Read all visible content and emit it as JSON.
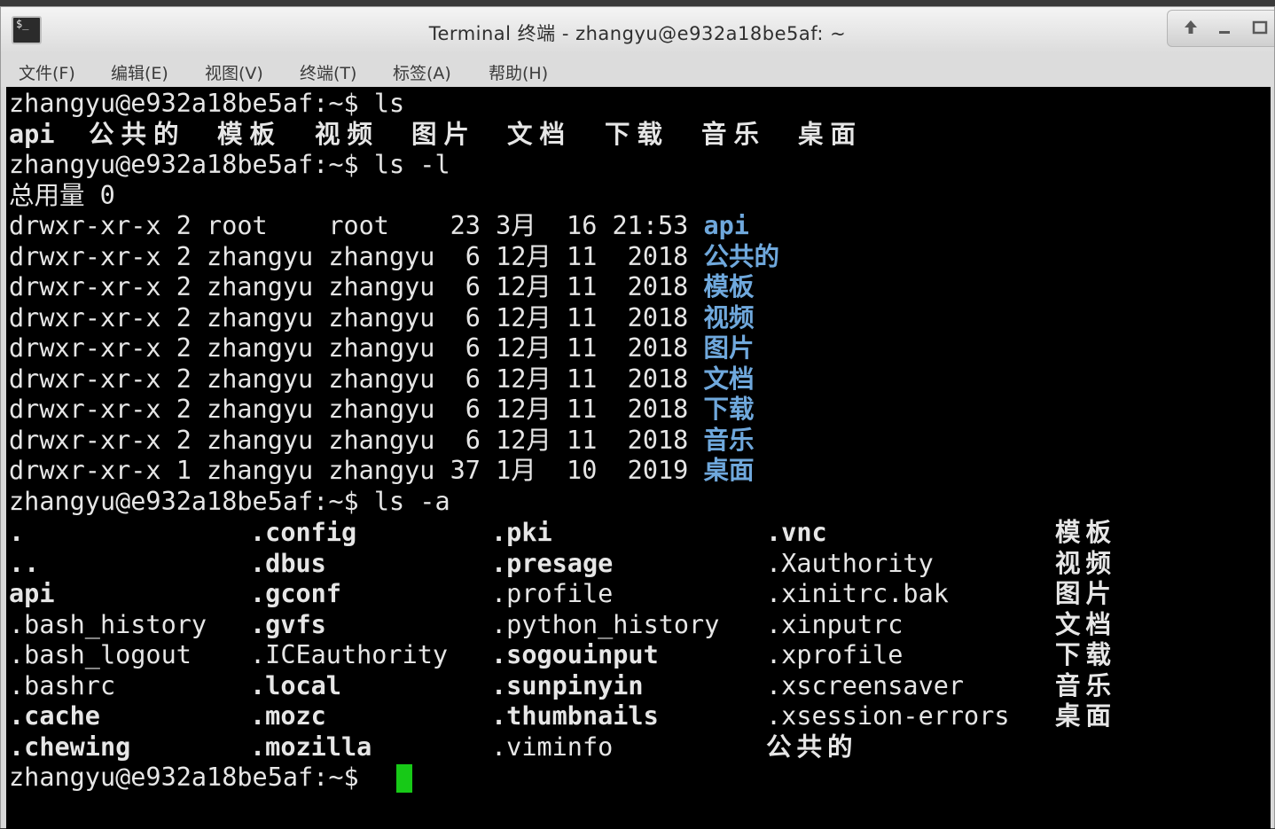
{
  "window": {
    "title": "Terminal 终端 - zhangyu@e932a18be5af: ~",
    "app_icon_prompt": "$_",
    "controls": [
      "up-arrow-icon",
      "minimize-icon",
      "maximize-icon"
    ]
  },
  "menu": [
    "文件(F)",
    "编辑(E)",
    "视图(V)",
    "终端(T)",
    "标签(A)",
    "帮助(H)"
  ],
  "terminal": {
    "prompt": "zhangyu@e932a18be5af:~$ ",
    "colors": {
      "background": "#000000",
      "text": "#e6e6e6",
      "directory": "#6fa8dc",
      "cursor": "#17c917"
    },
    "cmd1": "ls",
    "ls_output": [
      "api",
      "公共的",
      "模板",
      "视频",
      "图片",
      "文档",
      "下载",
      "音乐",
      "桌面"
    ],
    "cmd2": "ls -l",
    "total": "总用量 0",
    "long_rows": [
      {
        "meta": "drwxr-xr-x 2 root    root    23 3月  16 21:53 ",
        "name": "api"
      },
      {
        "meta": "drwxr-xr-x 2 zhangyu zhangyu  6 12月 11  2018 ",
        "name": "公共的"
      },
      {
        "meta": "drwxr-xr-x 2 zhangyu zhangyu  6 12月 11  2018 ",
        "name": "模板"
      },
      {
        "meta": "drwxr-xr-x 2 zhangyu zhangyu  6 12月 11  2018 ",
        "name": "视频"
      },
      {
        "meta": "drwxr-xr-x 2 zhangyu zhangyu  6 12月 11  2018 ",
        "name": "图片"
      },
      {
        "meta": "drwxr-xr-x 2 zhangyu zhangyu  6 12月 11  2018 ",
        "name": "文档"
      },
      {
        "meta": "drwxr-xr-x 2 zhangyu zhangyu  6 12月 11  2018 ",
        "name": "下载"
      },
      {
        "meta": "drwxr-xr-x 2 zhangyu zhangyu  6 12月 11  2018 ",
        "name": "音乐"
      },
      {
        "meta": "drwxr-xr-x 1 zhangyu zhangyu 37 1月  10  2019 ",
        "name": "桌面"
      }
    ],
    "cmd3": "ls -a",
    "la_columns": [
      [
        {
          "t": ".",
          "d": true
        },
        {
          "t": "..",
          "d": true
        },
        {
          "t": "api",
          "d": true
        },
        {
          "t": ".bash_history",
          "d": false
        },
        {
          "t": ".bash_logout",
          "d": false
        },
        {
          "t": ".bashrc",
          "d": false
        },
        {
          "t": ".cache",
          "d": true
        },
        {
          "t": ".chewing",
          "d": true
        }
      ],
      [
        {
          "t": ".config",
          "d": true
        },
        {
          "t": ".dbus",
          "d": true
        },
        {
          "t": ".gconf",
          "d": true
        },
        {
          "t": ".gvfs",
          "d": true
        },
        {
          "t": ".ICEauthority",
          "d": false
        },
        {
          "t": ".local",
          "d": true
        },
        {
          "t": ".mozc",
          "d": true
        },
        {
          "t": ".mozilla",
          "d": true
        }
      ],
      [
        {
          "t": ".pki",
          "d": true
        },
        {
          "t": ".presage",
          "d": true
        },
        {
          "t": ".profile",
          "d": false
        },
        {
          "t": ".python_history",
          "d": false
        },
        {
          "t": ".sogouinput",
          "d": true
        },
        {
          "t": ".sunpinyin",
          "d": true
        },
        {
          "t": ".thumbnails",
          "d": true
        },
        {
          "t": ".viminfo",
          "d": false
        }
      ],
      [
        {
          "t": ".vnc",
          "d": true
        },
        {
          "t": ".Xauthority",
          "d": false
        },
        {
          "t": ".xinitrc.bak",
          "d": false
        },
        {
          "t": ".xinputrc",
          "d": false
        },
        {
          "t": ".xprofile",
          "d": false
        },
        {
          "t": ".xscreensaver",
          "d": false
        },
        {
          "t": ".xsession-errors",
          "d": false
        },
        {
          "t": "公共的",
          "d": true
        }
      ],
      [
        {
          "t": "模板",
          "d": true
        },
        {
          "t": "视频",
          "d": true
        },
        {
          "t": "图片",
          "d": true
        },
        {
          "t": "文档",
          "d": true
        },
        {
          "t": "下载",
          "d": true
        },
        {
          "t": "音乐",
          "d": true
        },
        {
          "t": "桌面",
          "d": true
        }
      ]
    ]
  }
}
